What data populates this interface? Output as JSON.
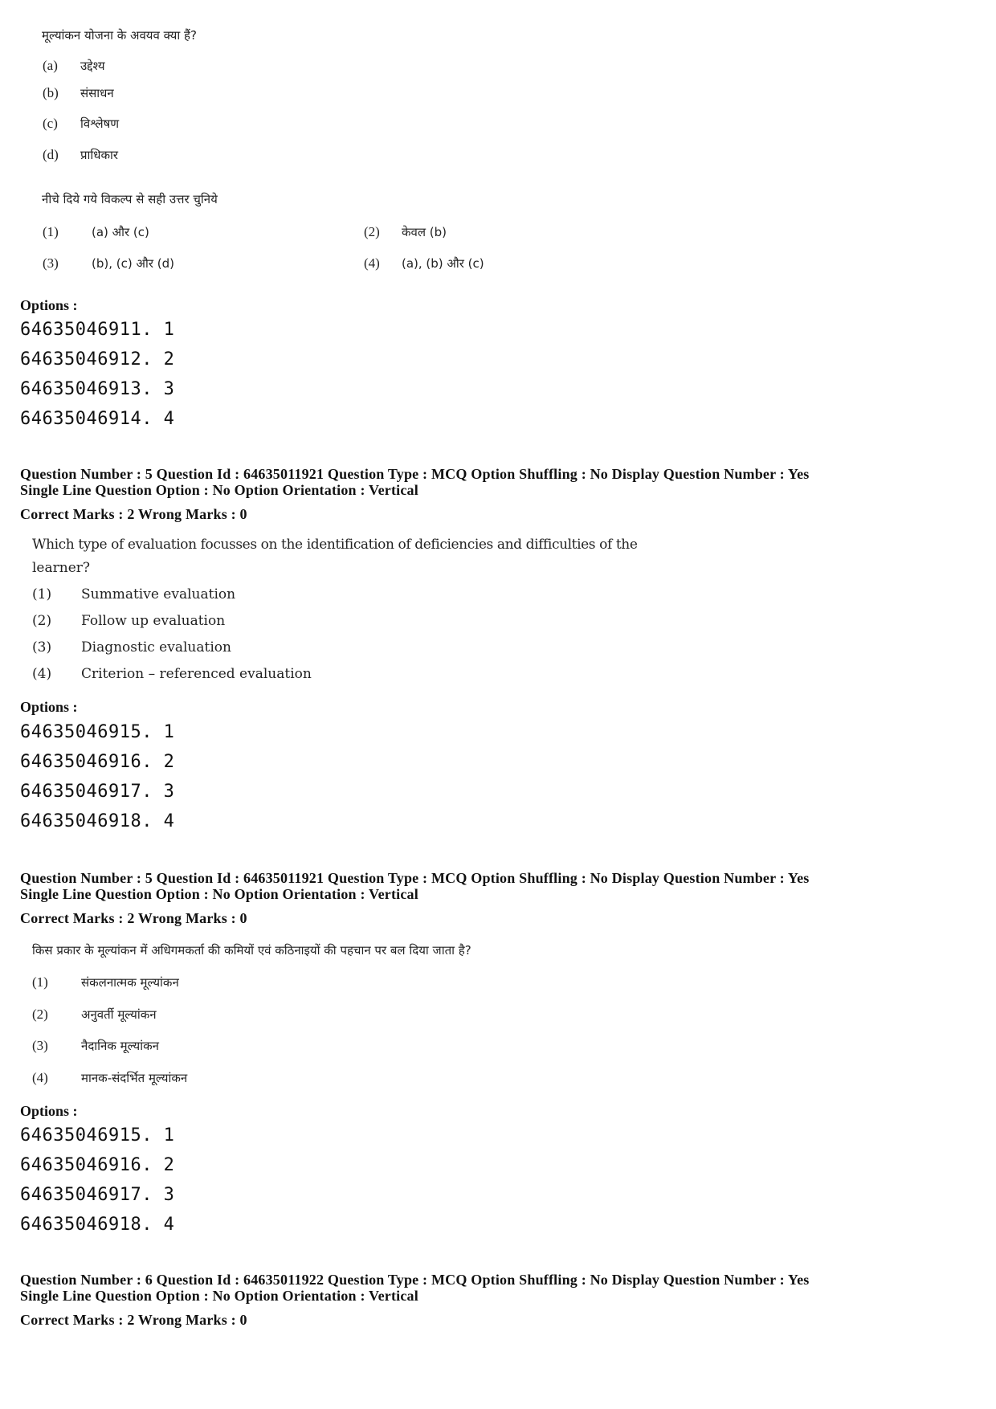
{
  "block1": {
    "question": "मूल्यांकन योजना के अवयव क्या हैं?",
    "items": [
      {
        "label": "(a)",
        "text": "उद्देश्य"
      },
      {
        "label": "(b)",
        "text": "संसाधन"
      },
      {
        "label": "(c)",
        "text": "विश्लेषण"
      },
      {
        "label": "(d)",
        "text": "प्राधिकार"
      }
    ],
    "instruction": "नीचे दिये गये विकल्प से सही उत्तर चुनिये",
    "choices": [
      {
        "label": "(1)",
        "text": "(a) और (c)"
      },
      {
        "label": "(2)",
        "text": "केवल (b)"
      },
      {
        "label": "(3)",
        "text": "(b), (c) और (d)"
      },
      {
        "label": "(4)",
        "text": "(a), (b) और (c)"
      }
    ],
    "options_heading": "Options :",
    "options": [
      "64635046911. 1",
      "64635046912. 2",
      "64635046913. 3",
      "64635046914. 4"
    ]
  },
  "block2": {
    "meta_line1": "Question Number : 5  Question Id : 64635011921  Question Type : MCQ  Option Shuffling : No  Display Question Number : Yes",
    "meta_line2": "Single Line Question Option : No  Option Orientation : Vertical",
    "marks": "Correct Marks : 2  Wrong Marks : 0",
    "question_line1": "Which type of evaluation focusses on the identification of deficiencies and difficulties of the",
    "question_line2": "learner?",
    "choices": [
      {
        "label": "(1)",
        "text": "Summative evaluation"
      },
      {
        "label": "(2)",
        "text": "Follow up evaluation"
      },
      {
        "label": "(3)",
        "text": "Diagnostic evaluation"
      },
      {
        "label": "(4)",
        "text": "Criterion – referenced evaluation"
      }
    ],
    "options_heading": "Options :",
    "options": [
      "64635046915. 1",
      "64635046916. 2",
      "64635046917. 3",
      "64635046918. 4"
    ]
  },
  "block3": {
    "meta_line1": "Question Number : 5  Question Id : 64635011921  Question Type : MCQ  Option Shuffling : No  Display Question Number : Yes",
    "meta_line2": "Single Line Question Option : No  Option Orientation : Vertical",
    "marks": "Correct Marks : 2  Wrong Marks : 0",
    "question": "किस प्रकार के मूल्यांकन में अधिगमकर्ता की कमियों एवं कठिनाइयों की पहचान पर बल दिया जाता है?",
    "choices": [
      {
        "label": "(1)",
        "text": "संकलनात्मक मूल्यांकन"
      },
      {
        "label": "(2)",
        "text": "अनुवर्ती मूल्यांकन"
      },
      {
        "label": "(3)",
        "text": "नैदानिक मूल्यांकन"
      },
      {
        "label": "(4)",
        "text": "मानक-संदर्भित मूल्यांकन"
      }
    ],
    "options_heading": "Options :",
    "options": [
      "64635046915. 1",
      "64635046916. 2",
      "64635046917. 3",
      "64635046918. 4"
    ]
  },
  "block4": {
    "meta_line1": "Question Number : 6  Question Id : 64635011922  Question Type : MCQ  Option Shuffling : No  Display Question Number : Yes",
    "meta_line2": "Single Line Question Option : No  Option Orientation : Vertical",
    "marks": "Correct Marks : 2  Wrong Marks : 0"
  }
}
